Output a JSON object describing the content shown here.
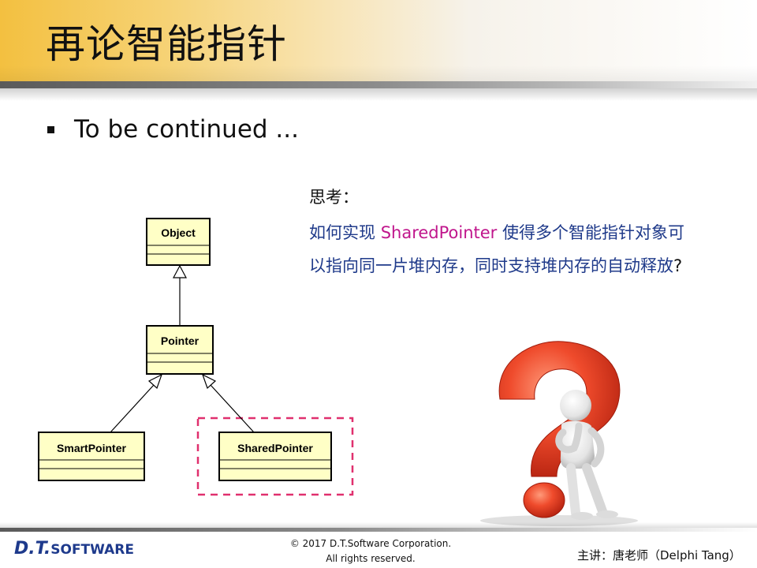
{
  "slide": {
    "title": "再论智能指针",
    "bullet": "To be continued ..."
  },
  "question": {
    "heading": "思考：",
    "line1_prefix": "如何实现 ",
    "line1_highlight": "SharedPointer",
    "line1_suffix": " 使得多个智能指针对象可",
    "line2_main": "以指向同一片堆内存，同时支持堆内存的自动释放",
    "line2_end": "?"
  },
  "uml": {
    "classes": {
      "object": "Object",
      "pointer": "Pointer",
      "smart": "SmartPointer",
      "shared": "SharedPointer"
    }
  },
  "footer": {
    "logo_dt": "D.T.",
    "logo_software": "SOFTWARE",
    "copyright_line1": "© 2017 D.T.Software Corporation.",
    "copyright_line2": "All rights reserved.",
    "lecturer": "主讲：唐老师（Delphi Tang）"
  },
  "colors": {
    "title_gold": "#f3c040",
    "question_blue": "#1f3a8a",
    "highlight_magenta": "#c0168c",
    "uml_fill": "#ffffc6",
    "dashed_box": "#e0306e",
    "question_mark_red": "#e8452a"
  }
}
